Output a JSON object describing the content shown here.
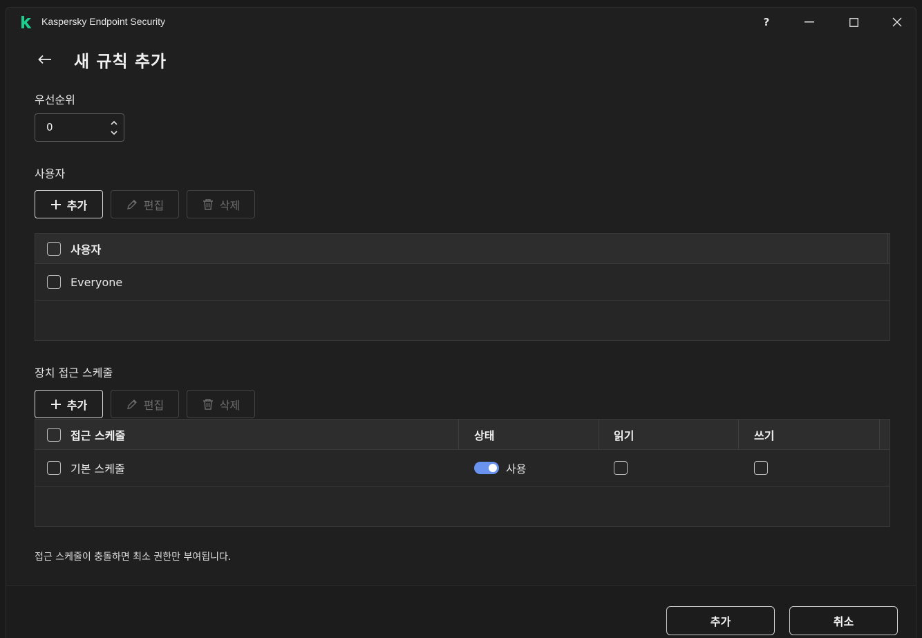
{
  "window": {
    "app_title": "Kaspersky Endpoint Security",
    "help_label": "?"
  },
  "page": {
    "title": "새 규칙 추가"
  },
  "priority": {
    "label": "우선순위",
    "value": "0"
  },
  "users": {
    "section_label": "사용자",
    "toolbar": {
      "add_label": "추가",
      "edit_label": "편집",
      "delete_label": "삭제"
    },
    "table": {
      "header": "사용자",
      "rows": [
        {
          "name": "Everyone",
          "checked": false
        }
      ]
    }
  },
  "schedules": {
    "section_label": "장치 접근 스케줄",
    "toolbar": {
      "add_label": "추가",
      "edit_label": "편집",
      "delete_label": "삭제"
    },
    "table": {
      "columns": [
        "접근 스케줄",
        "상태",
        "읽기",
        "쓰기"
      ],
      "rows": [
        {
          "name": "기본 스케줄",
          "status": "사용",
          "enabled": true,
          "read": false,
          "write": false
        }
      ]
    }
  },
  "note": "접근 스케줄이 충돌하면 최소 권한만 부여됩니다.",
  "footer": {
    "add_label": "추가",
    "cancel_label": "취소"
  },
  "colors": {
    "background": "#1f1f1f",
    "toggle_on": "#6a93f0",
    "brand_green": "#1bcf8f"
  }
}
